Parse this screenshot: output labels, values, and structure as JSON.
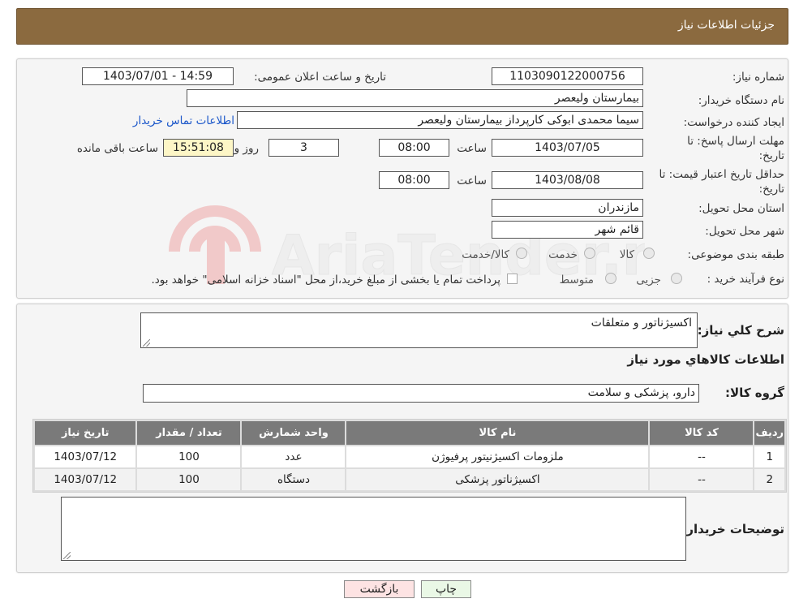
{
  "header": {
    "title": "جزئیات اطلاعات نیاز"
  },
  "fields": {
    "need_number": {
      "label": "شماره نیاز:",
      "value": "1103090122000756"
    },
    "announce_datetime": {
      "label": "تاریخ و ساعت اعلان عمومی:",
      "value": "1403/07/01 - 14:59"
    },
    "buyer_org": {
      "label": "نام دستگاه خریدار:",
      "value": "بیمارستان ولیعصر"
    },
    "requester": {
      "label": "ایجاد کننده درخواست:",
      "value": "سیما محمدی ابوکی کارپرداز بیمارستان ولیعصر",
      "contact_link": "اطلاعات تماس خریدار"
    },
    "deadline": {
      "label": "مهلت ارسال پاسخ: تا تاریخ:",
      "date": "1403/07/05",
      "time_label": "ساعت",
      "time": "08:00",
      "days": "3",
      "days_label": "روز و",
      "remaining": "15:51:08",
      "remaining_label": "ساعت باقی مانده"
    },
    "validity": {
      "label": "حداقل تاریخ اعتبار قیمت: تا تاریخ:",
      "date": "1403/08/08",
      "time_label": "ساعت",
      "time": "08:00"
    },
    "province": {
      "label": "استان محل تحویل:",
      "value": "مازندران"
    },
    "city": {
      "label": "شهر محل تحویل:",
      "value": "قائم شهر"
    },
    "category": {
      "label": "طبقه بندی موضوعی:",
      "options": [
        "کالا",
        "خدمت",
        "کالا/خدمت"
      ]
    },
    "process_type": {
      "label": "نوع فرآیند خرید :",
      "options": [
        "جزیی",
        "متوسط"
      ],
      "note": "پرداخت تمام یا بخشی از مبلغ خرید،از محل \"اسناد خزانه اسلامی\" خواهد بود."
    }
  },
  "watermark": {
    "text": "AriaTender.neT"
  },
  "details": {
    "summary_label": "شرح کلي نياز:",
    "summary_value": "اکسیژناتور و متعلقات",
    "items_heading": "اطلاعات کالاهاي مورد نياز",
    "group_label": "گروه کالا:",
    "group_value": "دارو، پزشکی و سلامت",
    "table": {
      "headers": [
        "رديف",
        "کد کالا",
        "نام کالا",
        "واحد شمارش",
        "تعداد / مقدار",
        "تاريخ نياز"
      ],
      "rows": [
        [
          "1",
          "--",
          "ملزومات اکسیژنیتور پرفیوژن",
          "عدد",
          "100",
          "1403/07/12"
        ],
        [
          "2",
          "--",
          "اکسیژناتور پزشکی",
          "دستگاه",
          "100",
          "1403/07/12"
        ]
      ]
    },
    "buyer_notes_label": "توضیحات خریدار:",
    "buyer_notes_value": ""
  },
  "buttons": {
    "print": "چاپ",
    "back": "بازگشت"
  },
  "colors": {
    "header_bg": "#8b6a3f",
    "table_header_bg": "#7a7a7a",
    "remaining_bg": "#fdf6c6",
    "print_bg": "#eaf8e6",
    "back_bg": "#fde3e3",
    "link": "#1a56c9"
  }
}
